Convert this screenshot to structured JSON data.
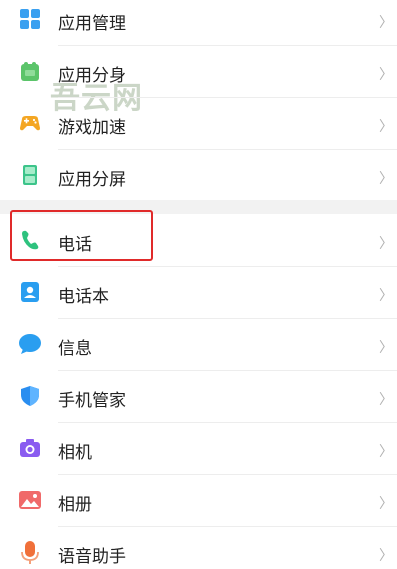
{
  "settings_list": {
    "items": [
      {
        "label": "应用管理",
        "icon": "app-grid-icon"
      },
      {
        "label": "应用分身",
        "icon": "app-clone-icon"
      },
      {
        "label": "游戏加速",
        "icon": "game-controller-icon"
      },
      {
        "label": "应用分屏",
        "icon": "split-screen-icon"
      },
      {
        "label": "电话",
        "icon": "phone-icon"
      },
      {
        "label": "电话本",
        "icon": "contacts-icon"
      },
      {
        "label": "信息",
        "icon": "message-bubble-icon"
      },
      {
        "label": "手机管家",
        "icon": "shield-icon"
      },
      {
        "label": "相机",
        "icon": "camera-icon"
      },
      {
        "label": "相册",
        "icon": "gallery-icon"
      },
      {
        "label": "语音助手",
        "icon": "microphone-icon"
      }
    ],
    "chevron": "〉"
  },
  "watermark": "吾云网",
  "colors": {
    "highlight_border": "#e02a2a",
    "app_grid": "#3aa0f0",
    "app_clone": "#5bc46a",
    "game": "#f4a623",
    "split_screen": "#3cc48a",
    "phone": "#2ec27e",
    "contacts": "#2a9ef0",
    "message": "#2a9ef0",
    "shield": "#2a8ef0",
    "camera": "#8a5cf0",
    "gallery": "#f06a6a",
    "microphone": "#f0703a"
  }
}
